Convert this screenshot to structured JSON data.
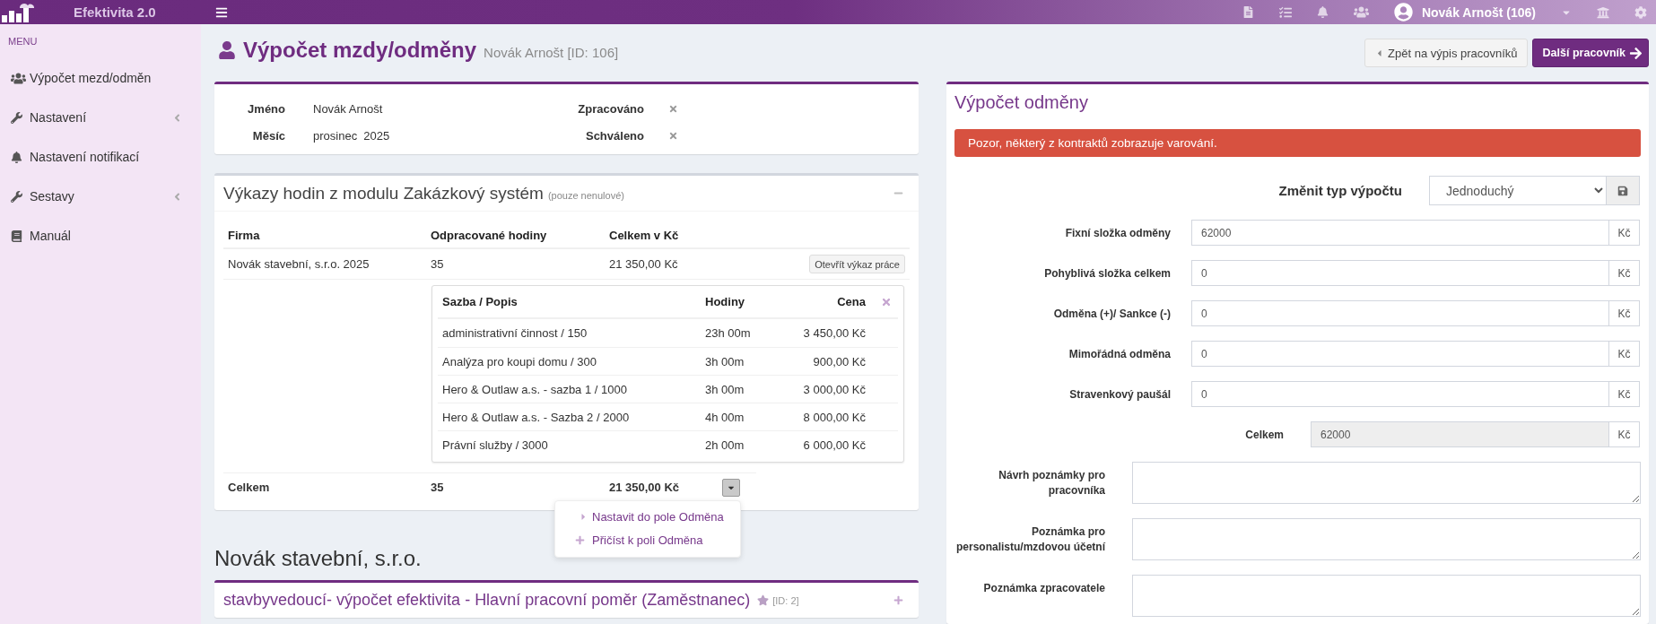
{
  "top_bar": {
    "app_title": "Efektivita 2.0",
    "user_name": "Novák Arnošt (106)"
  },
  "sidebar": {
    "heading": "MENU",
    "items": [
      {
        "label": "Výpočet mezd/odměn",
        "kind": "people",
        "submenu": false,
        "selected": false
      },
      {
        "label": "Nastavení",
        "kind": "wrench",
        "submenu": true,
        "selected": false
      },
      {
        "label": "Nastavení notifikací",
        "kind": "bell",
        "submenu": false,
        "selected": false
      },
      {
        "label": "Sestavy",
        "kind": "wrench",
        "submenu": true,
        "selected": false
      },
      {
        "label": "Manuál",
        "kind": "book",
        "submenu": false,
        "selected": false
      }
    ]
  },
  "page_header": {
    "title": "Výpočet mzdy/odměny",
    "subtitle": "Novák Arnošt [ID: 106]",
    "buttons": [
      {
        "label": "Zpět na výpis pracovníků",
        "kind": "back"
      },
      {
        "label": "Další pracovník",
        "kind": "next"
      }
    ]
  },
  "info": {
    "fields": [
      {
        "label": "Jméno",
        "value": "Novák Arnošt"
      },
      {
        "label": "Měsíc",
        "value": "prosinec  2025"
      }
    ],
    "statuses": [
      {
        "label": "Zpracováno",
        "done": false
      },
      {
        "label": "Schváleno",
        "done": false
      }
    ]
  },
  "timesheets": {
    "title": "Výkazy hodin z modulu Zakázkový systém",
    "note": "(pouze nenulové)",
    "expanded": true,
    "columns": [
      "Firma",
      "Odpracované hodiny",
      "Celkem v Kč"
    ],
    "rows": [
      {
        "company": "Novák stavební, s.r.o. 2025",
        "hours": "35",
        "total": "21 350,00 Kč",
        "button": "Otevřít výkaz práce",
        "detail": {
          "columns": [
            "Sazba / Popis",
            "Hodiny",
            "Cena"
          ],
          "rows": [
            {
              "description": "administrativní činnost / 150",
              "hours": "23h 00m",
              "price": "3 450,00 Kč"
            },
            {
              "description": "Analýza pro koupi domu / 300",
              "hours": "3h 00m",
              "price": "900,00 Kč"
            },
            {
              "description": "Hero & Outlaw a.s. - sazba 1 / 1000",
              "hours": "3h 00m",
              "price": "3 000,00 Kč"
            },
            {
              "description": "Hero & Outlaw a.s. - Sazba 2 / 2000",
              "hours": "4h 00m",
              "price": "8 000,00 Kč"
            },
            {
              "description": "Právní služby / 3000",
              "hours": "2h 00m",
              "price": "6 000,00 Kč"
            }
          ]
        }
      }
    ],
    "totals": {
      "label": "Celkem",
      "hours": "35",
      "total": "21 350,00 Kč"
    },
    "menu": {
      "open": true,
      "items": [
        {
          "label": "Nastavit do pole Odměna",
          "kind": "set"
        },
        {
          "label": "Přičíst k poli Odměna",
          "kind": "add"
        }
      ]
    }
  },
  "company": {
    "heading": "Novák stavební, s.r.o.",
    "contracts": [
      {
        "title": "stavbyvedoucí- výpočet efektivita - Hlavní pracovní poměr (Zaměstnanec)",
        "id_label": "[ID: 2]",
        "expanded": false
      }
    ]
  },
  "reward": {
    "title": "Výpočet odměny",
    "alert": "Pozor, některý z kontraktů zobrazuje varování.",
    "calc_type": {
      "label": "Změnit typ výpočtu",
      "value": "Jednoduchý"
    },
    "fields": [
      {
        "label": "Fixní složka odměny",
        "value": "62000",
        "unit": "Kč",
        "kind": "amount"
      },
      {
        "label": "Pohyblivá složka celkem",
        "value": "0",
        "unit": "Kč",
        "kind": "amount"
      },
      {
        "label": "Odměna (+)/ Sankce (-)",
        "value": "0",
        "unit": "Kč",
        "kind": "amount"
      },
      {
        "label": "Mimořádná odměna",
        "value": "0",
        "unit": "Kč",
        "kind": "amount"
      },
      {
        "label": "Stravenkový paušál",
        "value": "0",
        "unit": "Kč",
        "kind": "amount"
      },
      {
        "label": "Celkem",
        "value": "62000",
        "unit": "Kč",
        "kind": "total"
      }
    ],
    "notes": [
      {
        "label": "Návrh poznámky pro pracovníka"
      },
      {
        "label": "Poznámka pro personalistu/mzdovou účetní"
      },
      {
        "label": "Poznámka zpracovatele"
      }
    ]
  }
}
